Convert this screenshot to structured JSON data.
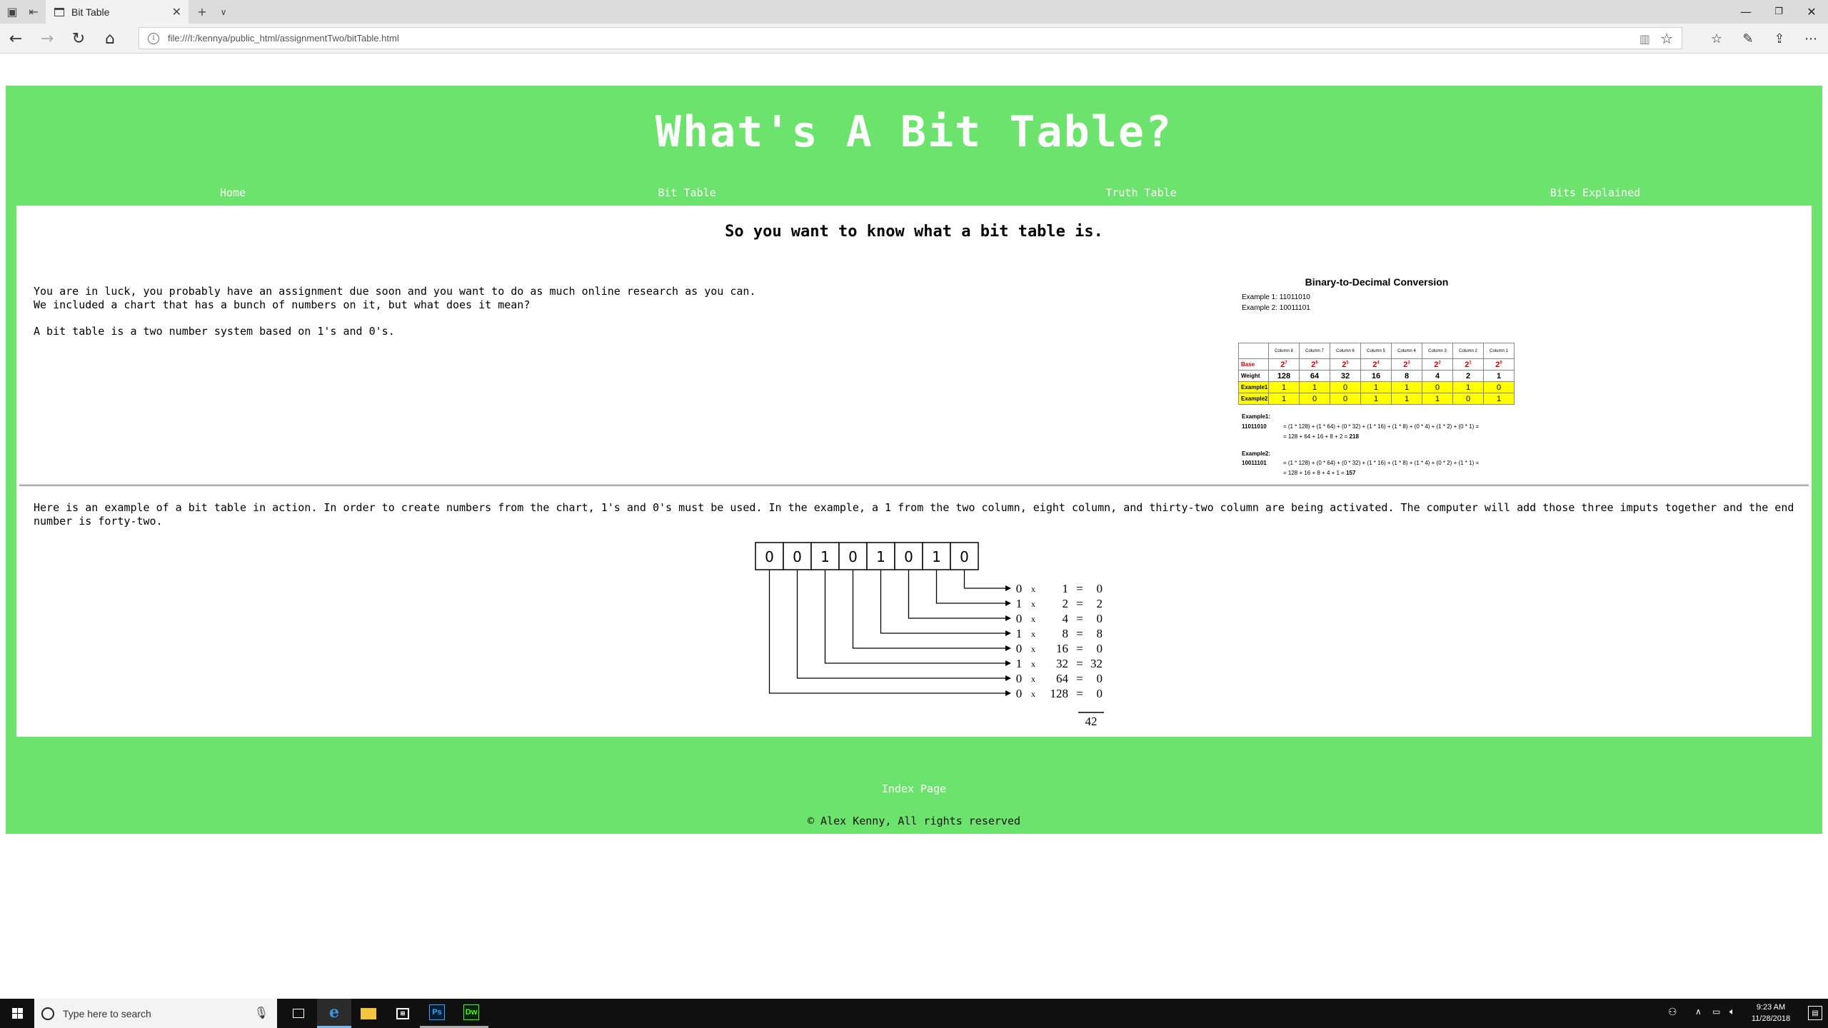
{
  "browser": {
    "tab_title": "Bit Table",
    "url": "file:///I:/kennya/public_html/assignmentTwo/bitTable.html"
  },
  "site": {
    "title": "What's A Bit Table?",
    "nav": [
      "Home",
      "Bit Table",
      "Truth Table",
      "Bits Explained"
    ],
    "heading": "So you want to know what a bit table is.",
    "intro_1": "You are in luck, you probably have an assignment due soon and you want to do as much online research as you can.",
    "intro_2": "We included a chart that has a bunch of numbers on it, but what does it mean?",
    "intro_3": "A bit table is a two number system based on 1's and 0's.",
    "example_paragraph": "Here is an example of a bit table in action. In order to create numbers from the chart, 1's and 0's must be used. In the example, a 1 from the two column, eight column, and thirty-two column are being activated. The computer will add those three imputs together and the end number is forty-two.",
    "footer_link": "Index Page",
    "copyright": "© Alex Kenny, All rights reserved"
  },
  "conversion_image": {
    "title": "Binary-to-Decimal Conversion",
    "example1": "Example 1: 11011010",
    "example2": "Example 2: 10011101",
    "columns": [
      "Column 8",
      "Column 7",
      "Column 6",
      "Column 5",
      "Column 4",
      "Column 3",
      "Column 2",
      "Column 1"
    ],
    "base_label": "Base",
    "bases": [
      "2",
      "2",
      "2",
      "2",
      "2",
      "2",
      "2",
      "2"
    ],
    "exponents": [
      "7",
      "6",
      "5",
      "4",
      "3",
      "2",
      "1",
      "0"
    ],
    "weight_label": "Weight",
    "weights": [
      "128",
      "64",
      "32",
      "16",
      "8",
      "4",
      "2",
      "1"
    ],
    "ex1_label": "Example1",
    "ex1_bits": [
      "1",
      "1",
      "0",
      "1",
      "1",
      "0",
      "1",
      "0"
    ],
    "ex2_label": "Example2",
    "ex2_bits": [
      "1",
      "0",
      "0",
      "1",
      "1",
      "1",
      "0",
      "1"
    ],
    "calc1_label": "Example1:",
    "calc1_num": "11011010",
    "calc1_line1": "= (1 * 128) + (1 * 64) + (0 * 32) + (1 * 16) + (1 * 8) + (0 * 4) + (1 * 2) + (0 * 1) =",
    "calc1_line2": "= 128 + 64 + 16 + 8 + 2 =",
    "calc1_result": "218",
    "calc2_label": "Example2:",
    "calc2_num": "10011101",
    "calc2_line1": "= (1 * 128) + (0 * 64) + (0 * 32) + (1 * 16) + (1 * 8) + (1 * 4) + (0 * 2) + (1 * 1) =",
    "calc2_line2": "= 128 + 16 + 8 + 4 + 1 =",
    "calc2_result": "157"
  },
  "bit_diagram": {
    "bits": [
      "0",
      "0",
      "1",
      "0",
      "1",
      "0",
      "1",
      "0"
    ],
    "rows": [
      {
        "bit": "0",
        "weight": "1",
        "product": "0"
      },
      {
        "bit": "1",
        "weight": "2",
        "product": "2"
      },
      {
        "bit": "0",
        "weight": "4",
        "product": "0"
      },
      {
        "bit": "1",
        "weight": "8",
        "product": "8"
      },
      {
        "bit": "0",
        "weight": "16",
        "product": "0"
      },
      {
        "bit": "1",
        "weight": "32",
        "product": "32"
      },
      {
        "bit": "0",
        "weight": "64",
        "product": "0"
      },
      {
        "bit": "0",
        "weight": "128",
        "product": "0"
      }
    ],
    "times_symbol": "x",
    "equals_symbol": "=",
    "total": "42"
  },
  "taskbar": {
    "search_placeholder": "Type here to search",
    "time": "9:23 AM",
    "date": "11/28/2018",
    "apps": [
      "task-view",
      "edge",
      "file-explorer",
      "store",
      "photoshop",
      "dreamweaver"
    ]
  },
  "colors": {
    "page_green": "#6ce36c",
    "highlight_yellow": "#ffff00",
    "base_red": "#d00000",
    "taskbar": "#101010"
  }
}
